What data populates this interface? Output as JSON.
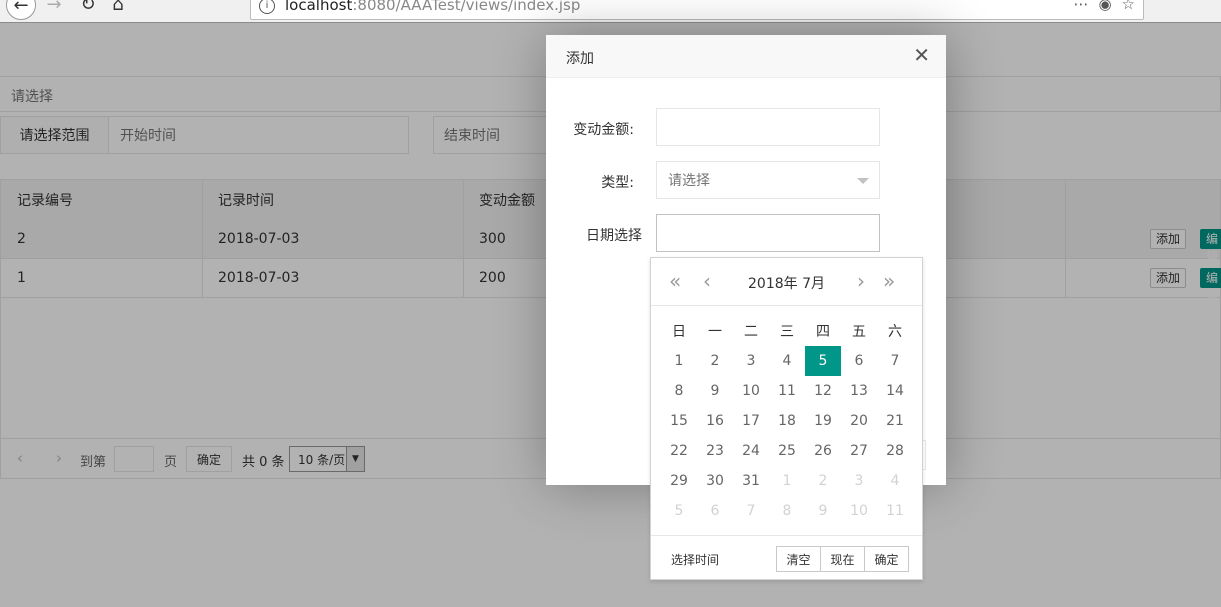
{
  "browser": {
    "url_host": "localhost",
    "url_path": ":8080/AAATest/views/index.jsp"
  },
  "filters": {
    "select_placeholder": "请选择",
    "range_label": "请选择范围",
    "start_placeholder": "开始时间",
    "end_placeholder": "结束时间"
  },
  "table": {
    "columns": [
      "记录编号",
      "记录时间",
      "变动金额"
    ],
    "rows": [
      {
        "id": "2",
        "time": "2018-07-03",
        "amount": "300",
        "add": "添加",
        "edit": "编辑"
      },
      {
        "id": "1",
        "time": "2018-07-03",
        "amount": "200",
        "add": "添加",
        "edit": "编辑"
      }
    ]
  },
  "pager": {
    "goto_label": "到第",
    "page_label": "页",
    "confirm": "确定",
    "total": "共 0 条",
    "page_size": "10 条/页"
  },
  "modal": {
    "title": "添加",
    "amount_label": "变动金额:",
    "type_label": "类型:",
    "type_placeholder": "请选择",
    "date_label": "日期选择"
  },
  "calendar": {
    "title": "2018年  7月",
    "weekdays": [
      "日",
      "一",
      "二",
      "三",
      "四",
      "五",
      "六"
    ],
    "days": [
      [
        "1",
        "2",
        "3",
        "4",
        "5",
        "6",
        "7"
      ],
      [
        "8",
        "9",
        "10",
        "11",
        "12",
        "13",
        "14"
      ],
      [
        "15",
        "16",
        "17",
        "18",
        "19",
        "20",
        "21"
      ],
      [
        "22",
        "23",
        "24",
        "25",
        "26",
        "27",
        "28"
      ],
      [
        "29",
        "30",
        "31",
        "1",
        "2",
        "3",
        "4"
      ],
      [
        "5",
        "6",
        "7",
        "8",
        "9",
        "10",
        "11"
      ]
    ],
    "selected_day": "5",
    "select_time": "选择时间",
    "clear": "清空",
    "now": "现在",
    "confirm": "确定",
    "accent_color": "#009688"
  }
}
